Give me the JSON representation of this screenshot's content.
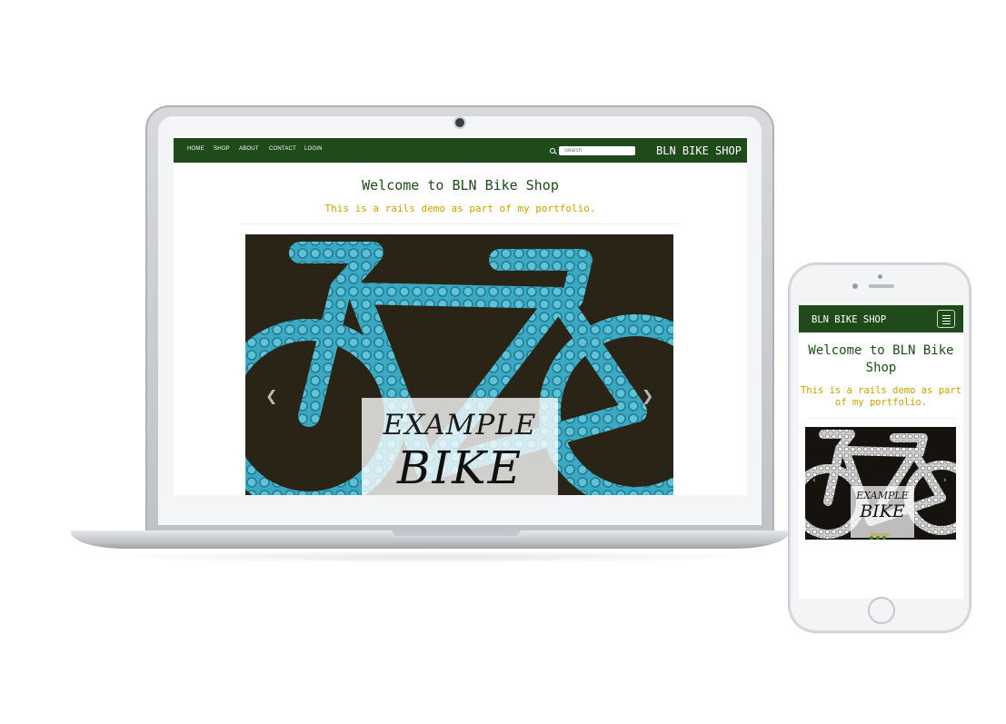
{
  "laptop": {
    "nav": {
      "items": [
        "HOME",
        "SHOP",
        "ABOUT",
        "CONTACT",
        "LOGIN"
      ],
      "search_placeholder": "Search",
      "brand": "BLN BIKE SHOP"
    },
    "hero": {
      "title": "Welcome to BLN Bike Shop",
      "tagline": "This is a rails demo as part of my portfolio."
    },
    "carousel": {
      "caption_line1": "EXAMPLE",
      "caption_line2": "BIKE",
      "prev_glyph": "❮",
      "next_glyph": "❯"
    }
  },
  "phone": {
    "nav": {
      "brand": "BLN BIKE SHOP"
    },
    "hero": {
      "title": "Welcome to BLN Bike Shop",
      "tagline": "This is a rails demo as part of my portfolio."
    },
    "carousel": {
      "caption_line1": "EXAMPLE",
      "caption_line2": "BIKE",
      "sub": "Bikernator",
      "prev_glyph": "‹",
      "next_glyph": "›",
      "indicators": 3
    }
  },
  "colors": {
    "nav_green": "#1f4a1a",
    "accent_gold": "#c8a100",
    "bike_cyan": "#3aa9c4"
  }
}
